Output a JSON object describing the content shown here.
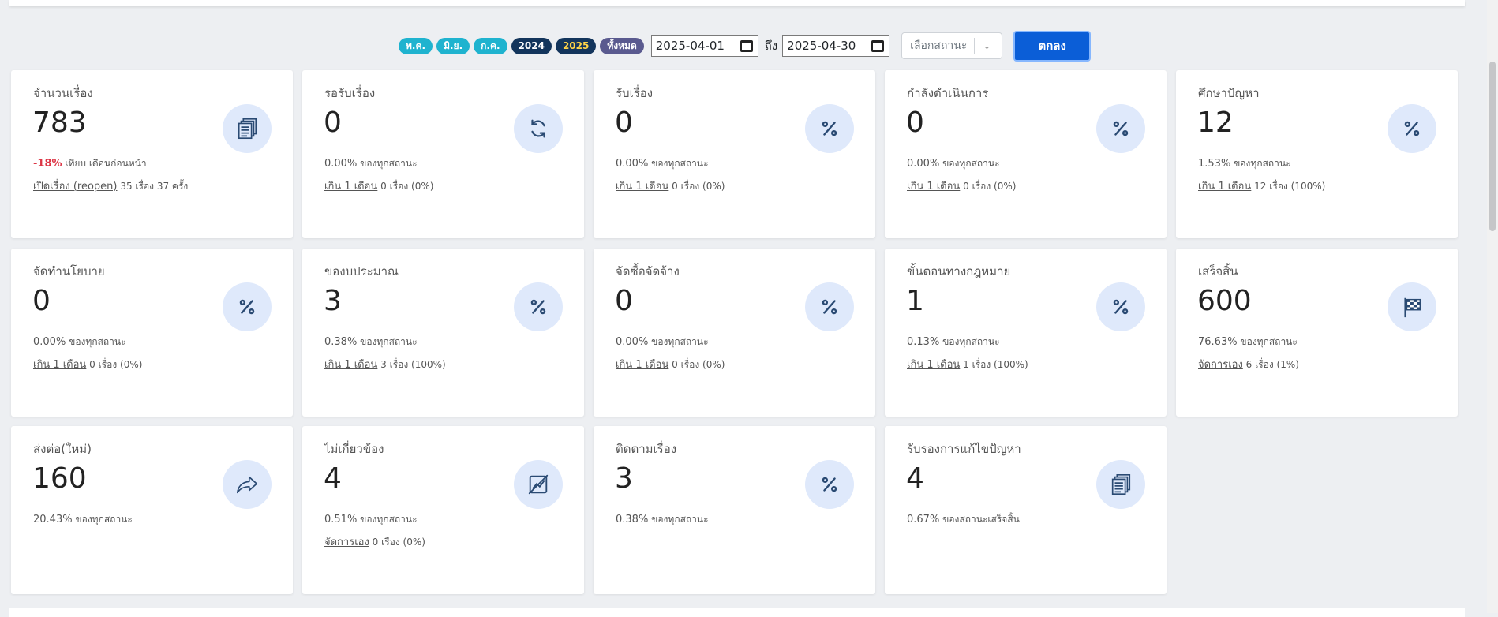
{
  "filter": {
    "pills": [
      {
        "label": "พ.ค.",
        "style": "teal"
      },
      {
        "label": "มิ.ย.",
        "style": "teal"
      },
      {
        "label": "ก.ค.",
        "style": "teal"
      },
      {
        "label": "2024",
        "style": "navy"
      },
      {
        "label": "2025",
        "style": "navy-gold"
      },
      {
        "label": "ทั้งหมด",
        "style": "purple"
      }
    ],
    "start_date": "2025-04-01",
    "to_label": "ถึง",
    "end_date": "2025-04-30",
    "status_placeholder": "เลือกสถานะ",
    "ok_label": "ตกลง"
  },
  "cards": [
    {
      "title": "จำนวนเรื่อง",
      "value": "783",
      "pct": "-18%",
      "pct_neg": true,
      "pct_text": "เทียบ เดือนก่อนหน้า",
      "link": "เปิดเรื่อง (reopen)",
      "link_text": "35 เรื่อง 37 ครั้ง",
      "icon": "documents-icon"
    },
    {
      "title": "รอรับเรื่อง",
      "value": "0",
      "pct": "0.00%",
      "pct_text": "ของทุกสถานะ",
      "link": "เกิน 1 เดือน",
      "link_text": "0 เรื่อง (0%)",
      "icon": "refresh-icon"
    },
    {
      "title": "รับเรื่อง",
      "value": "0",
      "pct": "0.00%",
      "pct_text": "ของทุกสถานะ",
      "link": "เกิน 1 เดือน",
      "link_text": "0 เรื่อง (0%)",
      "icon": "percent-icon"
    },
    {
      "title": "กำลังดำเนินการ",
      "value": "0",
      "pct": "0.00%",
      "pct_text": "ของทุกสถานะ",
      "link": "เกิน 1 เดือน",
      "link_text": "0 เรื่อง (0%)",
      "icon": "percent-icon"
    },
    {
      "title": "ศึกษาปัญหา",
      "value": "12",
      "pct": "1.53%",
      "pct_text": "ของทุกสถานะ",
      "link": "เกิน 1 เดือน",
      "link_text": "12 เรื่อง (100%)",
      "icon": "percent-icon"
    },
    {
      "title": "จัดทำนโยบาย",
      "value": "0",
      "pct": "0.00%",
      "pct_text": "ของทุกสถานะ",
      "link": "เกิน 1 เดือน",
      "link_text": "0 เรื่อง (0%)",
      "icon": "percent-icon"
    },
    {
      "title": "ของบประมาณ",
      "value": "3",
      "pct": "0.38%",
      "pct_text": "ของทุกสถานะ",
      "link": "เกิน 1 เดือน",
      "link_text": "3 เรื่อง (100%)",
      "icon": "percent-icon"
    },
    {
      "title": "จัดซื้อจัดจ้าง",
      "value": "0",
      "pct": "0.00%",
      "pct_text": "ของทุกสถานะ",
      "link": "เกิน 1 เดือน",
      "link_text": "0 เรื่อง (0%)",
      "icon": "percent-icon"
    },
    {
      "title": "ขั้นตอนทางกฎหมาย",
      "value": "1",
      "pct": "0.13%",
      "pct_text": "ของทุกสถานะ",
      "link": "เกิน 1 เดือน",
      "link_text": "1 เรื่อง (100%)",
      "icon": "percent-icon"
    },
    {
      "title": "เสร็จสิ้น",
      "value": "600",
      "pct": "76.63%",
      "pct_text": "ของทุกสถานะ",
      "link": "จัดการเอง",
      "link_text": "6 เรื่อง (1%)",
      "icon": "checkered-flag-icon"
    },
    {
      "title": "ส่งต่อ(ใหม่)",
      "value": "160",
      "pct": "20.43%",
      "pct_text": "ของทุกสถานะ",
      "link": "",
      "link_text": "",
      "icon": "share-arrow-icon"
    },
    {
      "title": "ไม่เกี่ยวข้อง",
      "value": "4",
      "pct": "0.51%",
      "pct_text": "ของทุกสถานะ",
      "link": "จัดการเอง",
      "link_text": "0 เรื่อง (0%)",
      "icon": "chart-slash-icon"
    },
    {
      "title": "ติดตามเรื่อง",
      "value": "3",
      "pct": "0.38%",
      "pct_text": "ของทุกสถานะ",
      "link": "",
      "link_text": "",
      "icon": "percent-icon"
    },
    {
      "title": "รับรองการแก้ไขปัญหา",
      "value": "4",
      "pct": "0.67%",
      "pct_text": "ของสถานะเสร็จสิ้น",
      "link": "",
      "link_text": "",
      "icon": "documents-icon"
    }
  ]
}
